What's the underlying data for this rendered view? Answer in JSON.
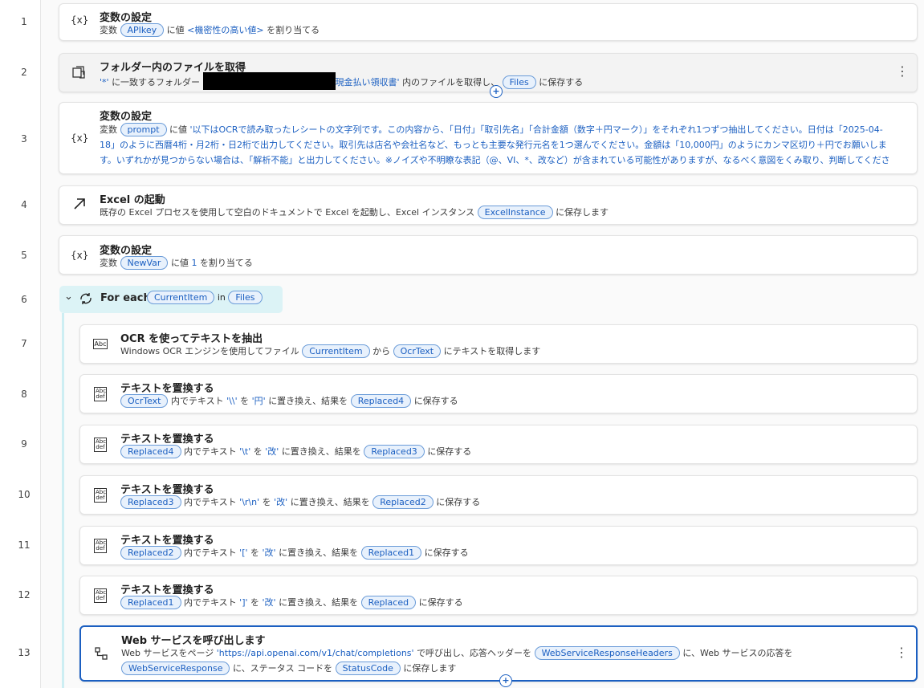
{
  "line_numbers": [
    "1",
    "2",
    "3",
    "4",
    "5",
    "6",
    "7",
    "8",
    "9",
    "10",
    "11",
    "12",
    "13"
  ],
  "actions": [
    {
      "icon": "{x}",
      "title": "変数の設定",
      "desc_pre": "変数",
      "var": "APIkey",
      "desc_mid": "に値",
      "value": "<機密性の高い値>",
      "desc_post": "を割り当てる"
    },
    {
      "icon": "folder-files-icon",
      "title": "フォルダー内のファイルを取得",
      "pattern": "'*'",
      "desc_mid": "に一致するフォルダー",
      "path_tail": "現金払い領収書'",
      "desc_mid2": "内のファイルを取得し、",
      "var": "Files",
      "desc_post": "に保存する"
    },
    {
      "icon": "{x}",
      "title": "変数の設定",
      "desc_pre": "変数",
      "var": "prompt",
      "desc_mid": "に値",
      "value": "'以下はOCRで読み取ったレシートの文字列です。この内容から、「日付」「取引先名」「合計金額（数字＋円マーク）」をそれぞれ1つずつ抽出してください。日付は「2025-04-18」のように西暦4桁・月2桁・日2桁で出力してください。取引先は店名や会社名など、もっとも主要な発行元名を1つ選んでください。金額は「10,000円」のようにカンマ区切り＋円でお願いします。いずれかが見つからない場合は、「解析不能」と出力してください。※ノイズや不明瞭な表記（@、VI、*、改など）が含まれている可能性がありますが、なるべく意図をくみ取り、判断してください。「@」「VI」「*」「改」などの記号ノイズが含まれ…"
    },
    {
      "icon": "arrow-up-right-icon",
      "title": "Excel の起動",
      "desc_pre": "既存の Excel プロセスを使用して空白のドキュメントで Excel を起動し、Excel インスタンス",
      "var": "ExcelInstance",
      "desc_post": "に保存します"
    },
    {
      "icon": "{x}",
      "title": "変数の設定",
      "desc_pre": "変数",
      "var": "NewVar",
      "desc_mid": "に値",
      "value": "1",
      "desc_post": "を割り当てる"
    },
    {
      "icon": "loop-icon",
      "title": "For each",
      "var": "CurrentItem",
      "desc_mid": "in",
      "var2": "Files"
    },
    {
      "icon": "Abc",
      "title": "OCR を使ってテキストを抽出",
      "desc_pre": "Windows OCR エンジンを使用してファイル",
      "var": "CurrentItem",
      "desc_mid": "から",
      "var2": "OcrText",
      "desc_post": "にテキストを取得します"
    },
    {
      "icon": "Abc def",
      "title": "テキストを置換する",
      "var": "OcrText",
      "desc_mid": "内でテキスト",
      "find": "'\\\\'",
      "desc_mid2": "を",
      "repl": "'円'",
      "desc_mid3": "に置き換え、結果を",
      "var2": "Replaced4",
      "desc_post": "に保存する"
    },
    {
      "icon": "Abc def",
      "title": "テキストを置換する",
      "var": "Replaced4",
      "desc_mid": "内でテキスト",
      "find": "'\\t'",
      "desc_mid2": "を",
      "repl": "'改'",
      "desc_mid3": "に置き換え、結果を",
      "var2": "Replaced3",
      "desc_post": "に保存する"
    },
    {
      "icon": "Abc def",
      "title": "テキストを置換する",
      "var": "Replaced3",
      "desc_mid": "内でテキスト",
      "find": "'\\r\\n'",
      "desc_mid2": "を",
      "repl": "'改'",
      "desc_mid3": "に置き換え、結果を",
      "var2": "Replaced2",
      "desc_post": "に保存する"
    },
    {
      "icon": "Abc def",
      "title": "テキストを置換する",
      "var": "Replaced2",
      "desc_mid": "内でテキスト",
      "find": "'['",
      "desc_mid2": "を",
      "repl": "'改'",
      "desc_mid3": "に置き換え、結果を",
      "var2": "Replaced1",
      "desc_post": "に保存する"
    },
    {
      "icon": "Abc def",
      "title": "テキストを置換する",
      "var": "Replaced1",
      "desc_mid": "内でテキスト",
      "find": "']'",
      "desc_mid2": "を",
      "repl": "'改'",
      "desc_mid3": "に置き換え、結果を",
      "var2": "Replaced",
      "desc_post": "に保存する"
    },
    {
      "icon": "web-service-icon",
      "title": "Web サービスを呼び出します",
      "desc_pre": "Web サービスをページ",
      "url": "'https://api.openai.com/v1/chat/completions'",
      "desc_mid": "で呼び出し、応答ヘッダーを",
      "var": "WebServiceResponseHeaders",
      "desc_mid2": "に、Web サービスの応答を",
      "var2": "WebServiceResponse",
      "desc_mid3": "に、ステータス コードを",
      "var3": "StatusCode",
      "desc_post": "に保存します"
    }
  ],
  "menu_icon": "⋮",
  "add_icon": "+",
  "chevron": "⌄"
}
